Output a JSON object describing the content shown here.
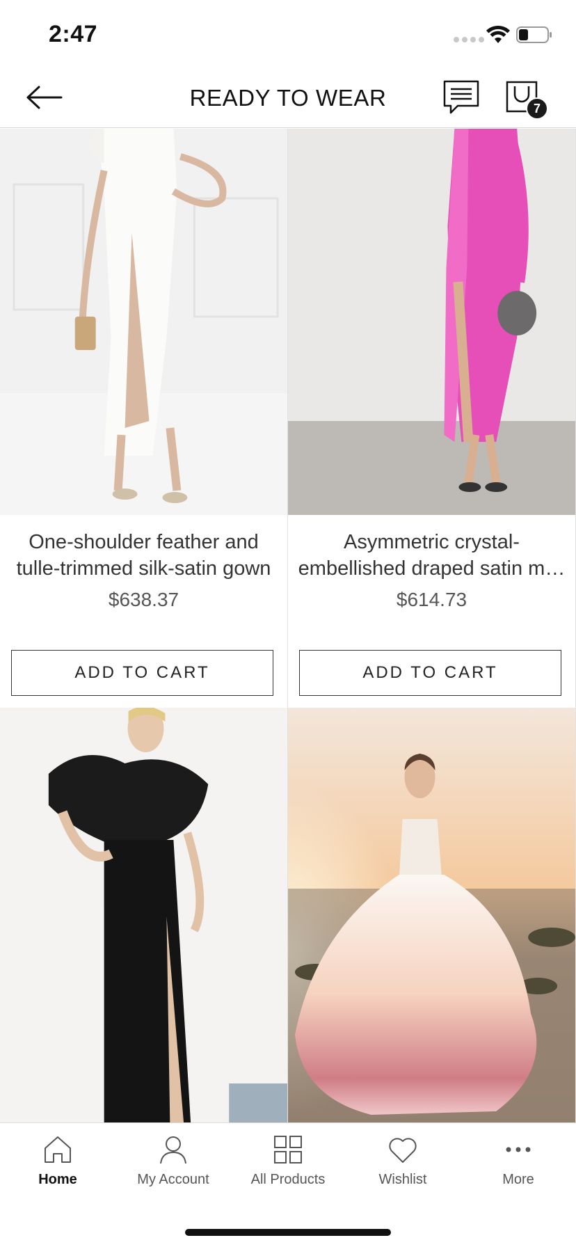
{
  "status_bar": {
    "time": "2:47"
  },
  "header": {
    "title": "READY TO WEAR",
    "cart_count": "7"
  },
  "products": [
    {
      "name": "One-shoulder feather and tulle-trimmed silk-satin gown",
      "price": "$638.37",
      "cta": "ADD TO CART"
    },
    {
      "name": "Asymmetric crystal-embellished draped satin midi dress",
      "price": "$614.73",
      "cta": "ADD TO CART"
    },
    {
      "name": "",
      "price": "",
      "cta": ""
    },
    {
      "name": "",
      "price": "",
      "cta": ""
    }
  ],
  "bottom_nav": {
    "items": [
      {
        "label": "Home",
        "icon": "home-icon"
      },
      {
        "label": "My Account",
        "icon": "user-icon"
      },
      {
        "label": "All Products",
        "icon": "grid-icon"
      },
      {
        "label": "Wishlist",
        "icon": "heart-icon"
      },
      {
        "label": "More",
        "icon": "more-icon"
      }
    ],
    "active_index": 0
  },
  "colors": {
    "accent": "#111111",
    "badge": "#1a1a1a",
    "border": "#d8d8d8"
  }
}
